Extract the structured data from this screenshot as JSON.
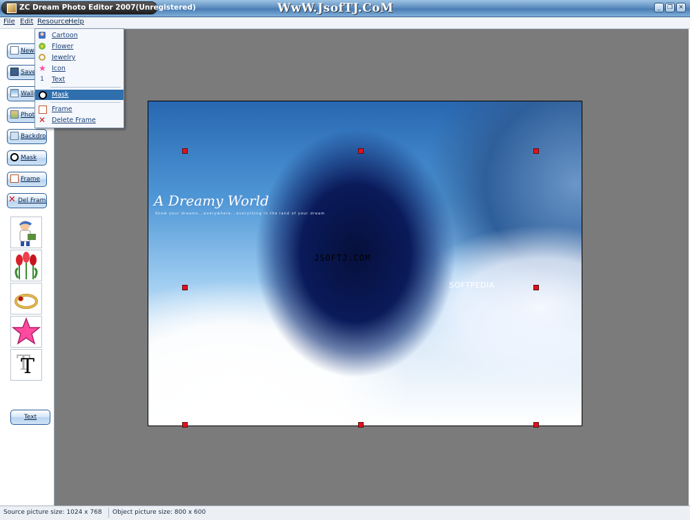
{
  "window": {
    "title": "ZC Dream Photo Editor 2007(Unregistered)",
    "watermark": "WwW.JsofTJ.CoM",
    "controls": {
      "minimize": "_",
      "restore": "❐",
      "close": "✕"
    }
  },
  "menubar": {
    "items": [
      "File",
      "Edit",
      "Resource",
      "Help"
    ]
  },
  "sidebar": {
    "buttons": [
      "New",
      "Save",
      "Wallp",
      "Photo",
      "Backdrop",
      "Mask",
      "Frame",
      "Del Frame"
    ],
    "thumbnails": [
      "cartoon-thumbnail",
      "flower-thumbnail",
      "jewelry-thumbnail",
      "icon-thumbnail",
      "text-thumbnail"
    ],
    "thumb_text_glyph": "T",
    "text_button": "Text"
  },
  "dropdown": {
    "items": [
      {
        "label": "Cartoon",
        "icon": "cartoon-icon"
      },
      {
        "label": "Flower",
        "icon": "flower-icon"
      },
      {
        "label": "Jewelry",
        "icon": "jewelry-icon"
      },
      {
        "label": "Icon",
        "icon": "star-icon"
      },
      {
        "label": "Text",
        "icon": "text-icon"
      },
      {
        "label": "Mask",
        "icon": "mask-icon",
        "selected": true
      },
      {
        "label": "Frame",
        "icon": "frame-icon"
      },
      {
        "label": "Delete Frame",
        "icon": "delete-icon"
      }
    ],
    "text_icon_glyph": "1"
  },
  "canvas": {
    "photo_title": "A Dreamy World",
    "photo_subtitle": "Show your dreams...everywhere...everything in the land of your dream",
    "watermark_1": "JSOFTJ.COM",
    "watermark_2": "SOFTPEDIA"
  },
  "statusbar": {
    "source_size": "Source picture size: 1024 x 768",
    "object_size": "Object picture size: 800 x 600"
  },
  "colors": {
    "selection": "#2f6fae",
    "handle": "#e0131f",
    "workspace": "#7b7b7b"
  }
}
